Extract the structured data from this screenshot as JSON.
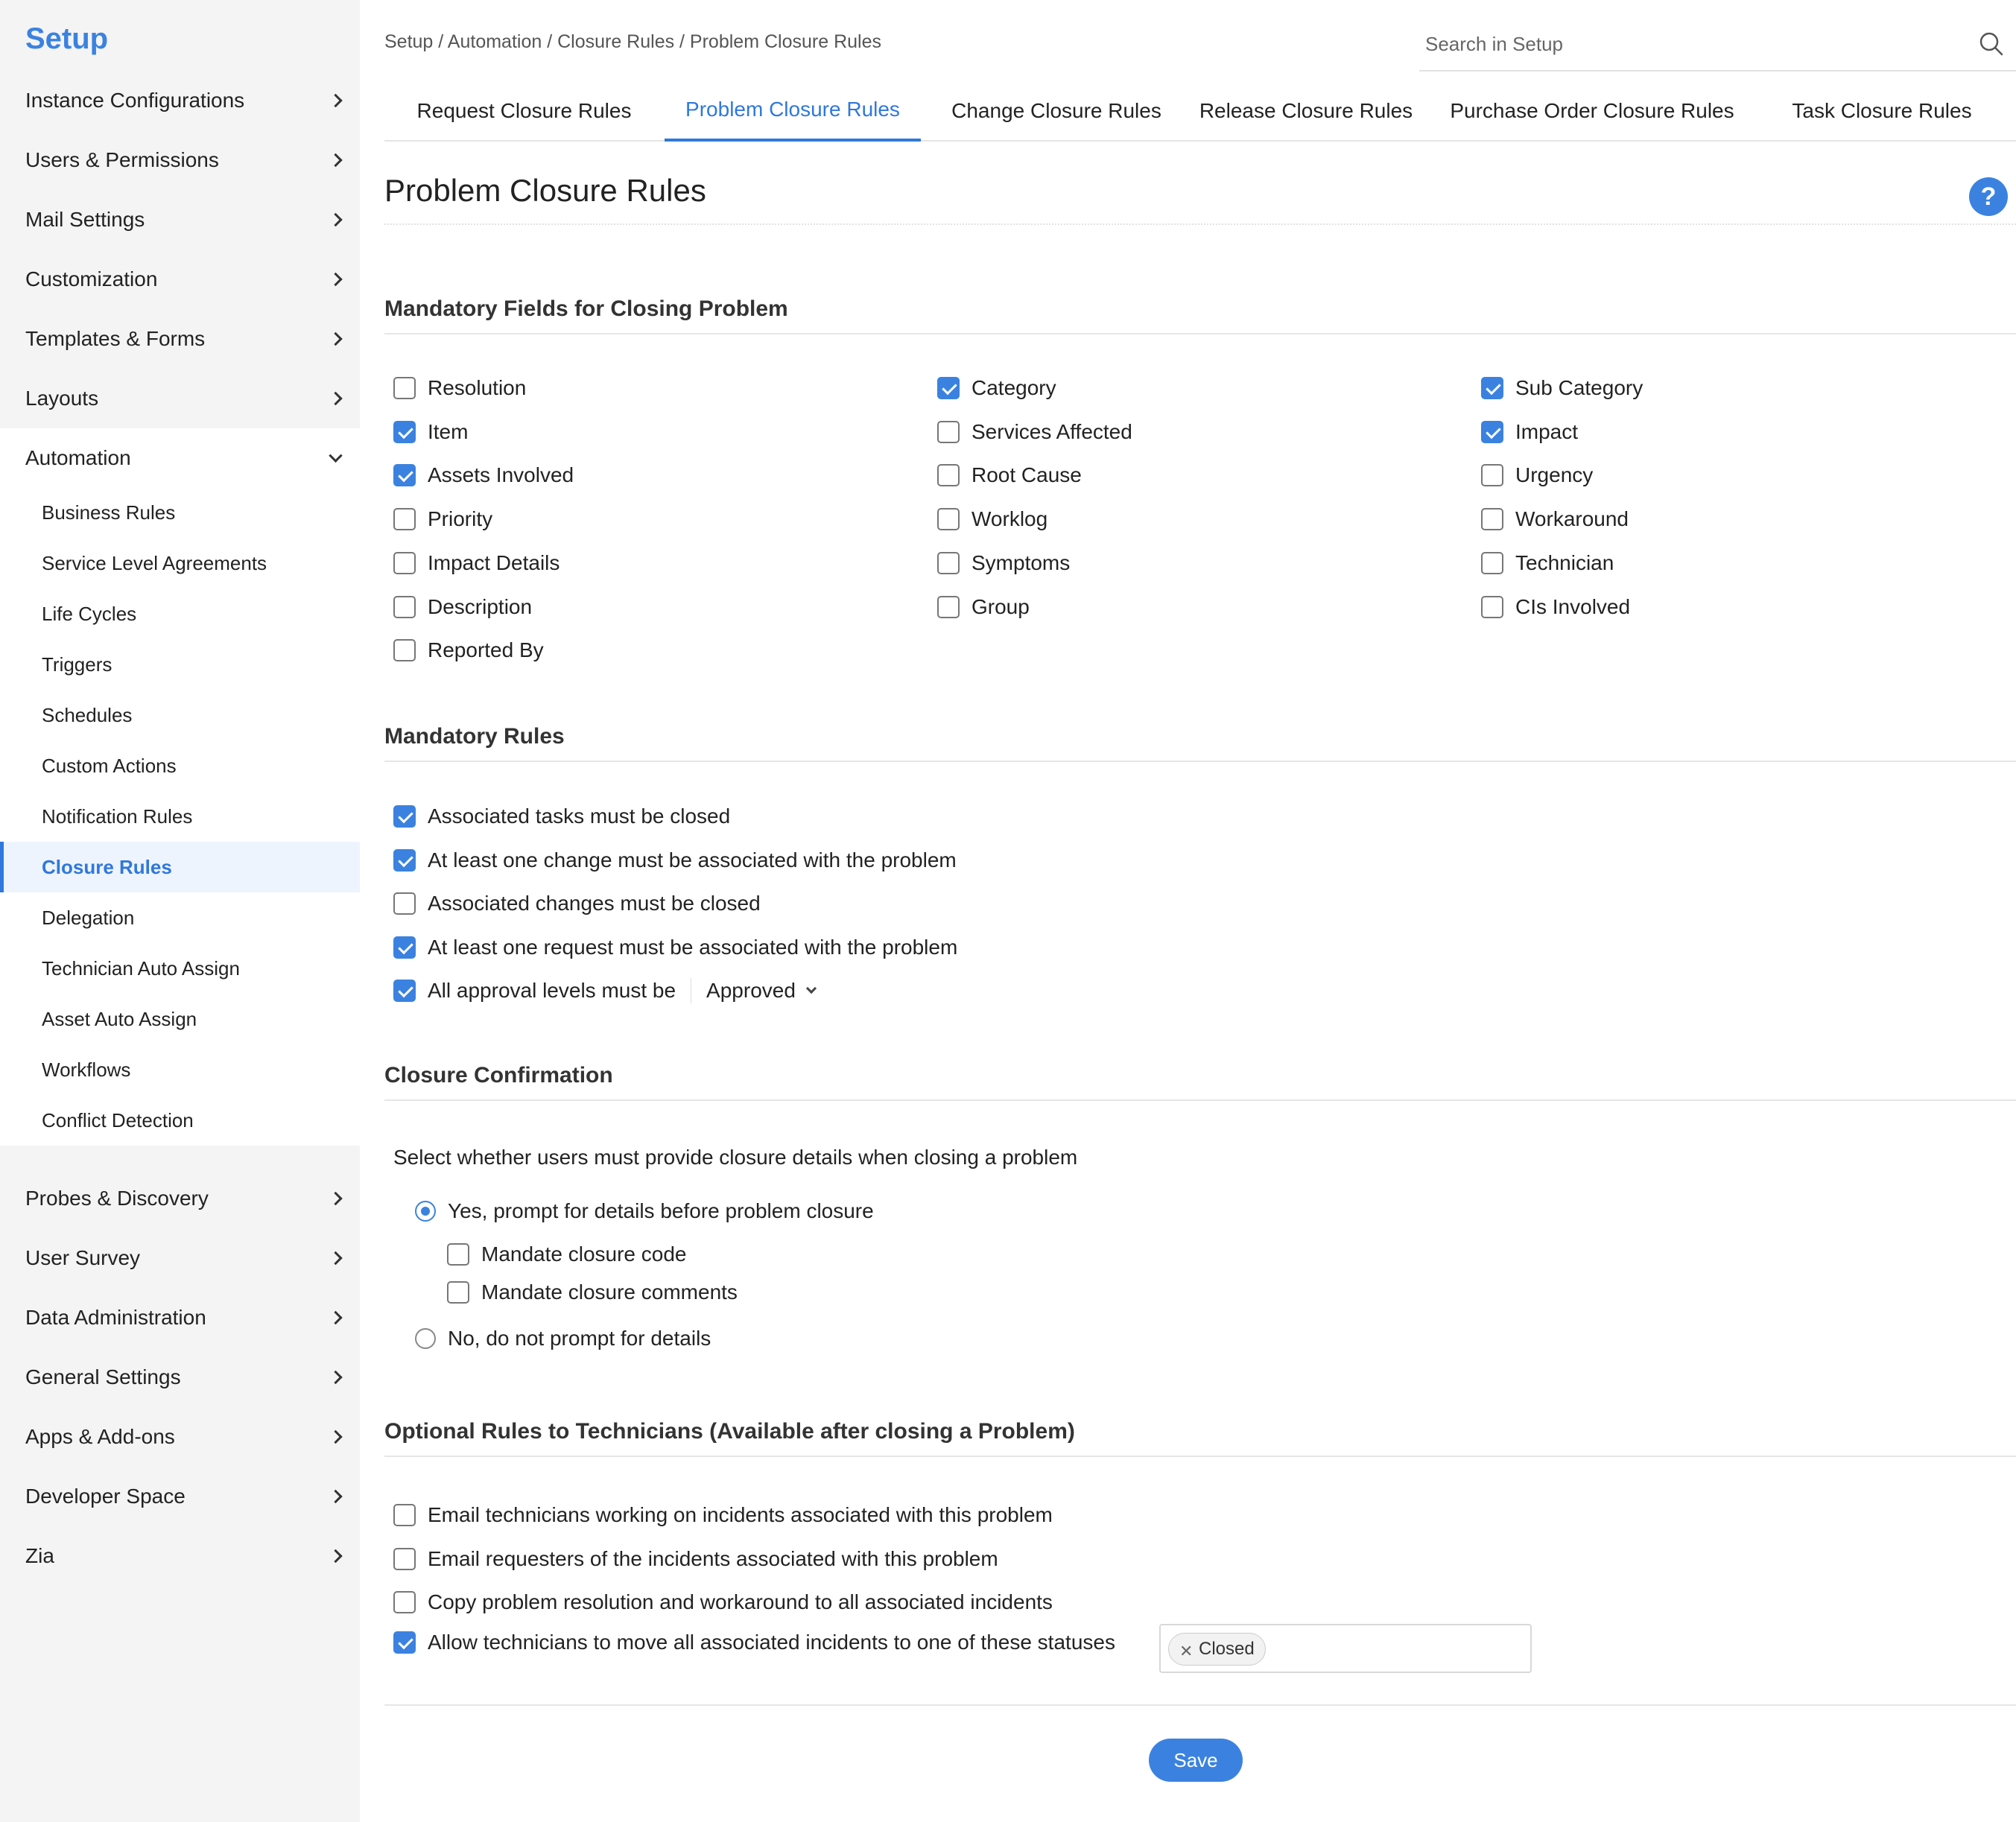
{
  "sidebar": {
    "title": "Setup",
    "items_top": [
      {
        "label": "Instance Configurations"
      },
      {
        "label": "Users & Permissions"
      },
      {
        "label": "Mail Settings"
      },
      {
        "label": "Customization"
      },
      {
        "label": "Templates & Forms"
      },
      {
        "label": "Layouts"
      }
    ],
    "automation": {
      "label": "Automation"
    },
    "automation_sub": [
      {
        "label": "Business Rules"
      },
      {
        "label": "Service Level Agreements"
      },
      {
        "label": "Life Cycles"
      },
      {
        "label": "Triggers"
      },
      {
        "label": "Schedules"
      },
      {
        "label": "Custom Actions"
      },
      {
        "label": "Notification Rules"
      },
      {
        "label": "Closure Rules",
        "active": true
      },
      {
        "label": "Delegation"
      },
      {
        "label": "Technician Auto Assign"
      },
      {
        "label": "Asset Auto Assign"
      },
      {
        "label": "Workflows"
      },
      {
        "label": "Conflict Detection"
      }
    ],
    "items_bottom": [
      {
        "label": "Probes & Discovery"
      },
      {
        "label": "User Survey"
      },
      {
        "label": "Data Administration"
      },
      {
        "label": "General Settings"
      },
      {
        "label": "Apps & Add-ons"
      },
      {
        "label": "Developer Space"
      },
      {
        "label": "Zia"
      }
    ]
  },
  "header": {
    "breadcrumb": "Setup / Automation / Closure Rules / Problem Closure Rules",
    "search_placeholder": "Search in Setup"
  },
  "tabs": [
    {
      "label": "Request Closure Rules"
    },
    {
      "label": "Problem Closure Rules",
      "active": true
    },
    {
      "label": "Change Closure Rules"
    },
    {
      "label": "Release Closure Rules"
    },
    {
      "label": "Purchase Order Closure Rules"
    },
    {
      "label": "Task Closure Rules"
    }
  ],
  "page": {
    "title": "Problem Closure Rules",
    "help": "?"
  },
  "mandatory_fields": {
    "heading": "Mandatory Fields for Closing Problem",
    "col1": [
      {
        "label": "Resolution",
        "checked": false
      },
      {
        "label": "Item",
        "checked": true
      },
      {
        "label": "Assets Involved",
        "checked": true
      },
      {
        "label": "Priority",
        "checked": false
      },
      {
        "label": "Impact Details",
        "checked": false
      },
      {
        "label": "Description",
        "checked": false
      },
      {
        "label": "Reported By",
        "checked": false
      }
    ],
    "col2": [
      {
        "label": "Category",
        "checked": true
      },
      {
        "label": "Services Affected",
        "checked": false
      },
      {
        "label": "Root Cause",
        "checked": false
      },
      {
        "label": "Worklog",
        "checked": false
      },
      {
        "label": "Symptoms",
        "checked": false
      },
      {
        "label": "Group",
        "checked": false
      }
    ],
    "col3": [
      {
        "label": "Sub Category",
        "checked": true
      },
      {
        "label": "Impact",
        "checked": true
      },
      {
        "label": "Urgency",
        "checked": false
      },
      {
        "label": "Workaround",
        "checked": false
      },
      {
        "label": "Technician",
        "checked": false
      },
      {
        "label": "CIs Involved",
        "checked": false
      }
    ]
  },
  "mandatory_rules": {
    "heading": "Mandatory Rules",
    "rules": [
      {
        "label": "Associated tasks must be closed",
        "checked": true
      },
      {
        "label": "At least one change must be associated with the problem",
        "checked": true
      },
      {
        "label": "Associated changes must be closed",
        "checked": false
      },
      {
        "label": "At least one request must be associated with the problem",
        "checked": true
      },
      {
        "label": "All approval levels must be",
        "checked": true
      }
    ],
    "approval_value": "Approved"
  },
  "closure_confirmation": {
    "heading": "Closure Confirmation",
    "description": "Select whether users must provide closure details when closing a problem",
    "yes_label": "Yes, prompt for details before problem closure",
    "yes_selected": true,
    "mandate_code": {
      "label": "Mandate closure code",
      "checked": false
    },
    "mandate_comments": {
      "label": "Mandate closure comments",
      "checked": false
    },
    "no_label": "No, do not prompt for details",
    "no_selected": false
  },
  "optional_rules": {
    "heading": "Optional Rules to Technicians (Available after closing a Problem)",
    "rules": [
      {
        "label": "Email technicians working on incidents associated with this problem",
        "checked": false
      },
      {
        "label": "Email requesters of the incidents associated with this problem",
        "checked": false
      },
      {
        "label": "Copy problem resolution and workaround to all associated incidents",
        "checked": false
      },
      {
        "label": "Allow technicians to move all associated incidents to one of these statuses",
        "checked": true
      }
    ],
    "statuses": [
      "Closed"
    ]
  },
  "actions": {
    "save_label": "Save"
  },
  "colors": {
    "accent": "#3b82e0",
    "active_nav_bg": "#eef4fd",
    "sidebar_bg": "#f4f4f4"
  },
  "icons": [
    "chevron-right-icon",
    "chevron-down-icon",
    "search-icon",
    "help-icon",
    "remove-chip-icon"
  ]
}
